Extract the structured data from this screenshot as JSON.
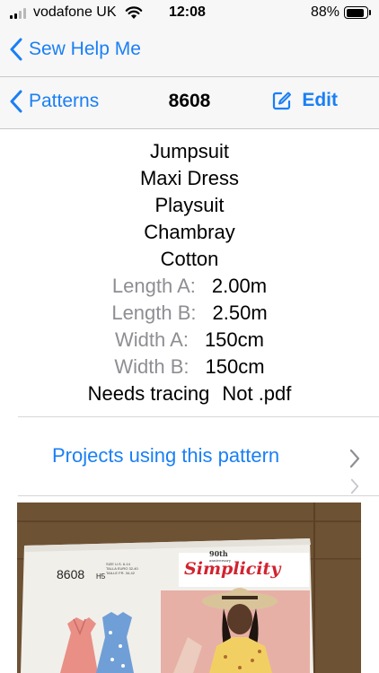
{
  "status_bar": {
    "carrier": "vodafone UK",
    "time": "12:08",
    "battery_percent": "88%",
    "battery_level": 0.88
  },
  "app_nav": {
    "back_label": "Sew Help Me"
  },
  "page_nav": {
    "back_label": "Patterns",
    "title": "8608",
    "edit_label": "Edit"
  },
  "details": {
    "tags": [
      "Jumpsuit",
      "Maxi Dress",
      "Playsuit",
      "Chambray",
      "Cotton"
    ],
    "measurements": [
      {
        "key": "Length A:",
        "value": "2.00m"
      },
      {
        "key": "Length B:",
        "value": "2.50m"
      },
      {
        "key": "Width A:",
        "value": "150cm"
      },
      {
        "key": "Width B:",
        "value": "150cm"
      }
    ],
    "needs_tracing": "Needs tracing",
    "file_note": "Not .pdf"
  },
  "projects": {
    "label": "Projects using this pattern"
  },
  "pattern_photo": {
    "pattern_number": "8608",
    "size_code": "H5",
    "size_text_1": "SIZE U.S. 6-14",
    "size_text_2": "TALLA EURO 32-40",
    "size_text_3": "TAILLE FR. 34-42",
    "anniversary": "90th",
    "anniversary_word": "anniversary",
    "brand": "Simplicity",
    "colors": {
      "wood": "#6e5234",
      "envelope": "#f1efea",
      "brand_red": "#d2222e",
      "dress_pink": "#e98f86",
      "dress_blue": "#6f9fd6",
      "backdrop": "#e7b0a6",
      "hat": "#d9c49a",
      "skin": "#5a3a28",
      "top_yellow": "#f2cf63"
    }
  }
}
